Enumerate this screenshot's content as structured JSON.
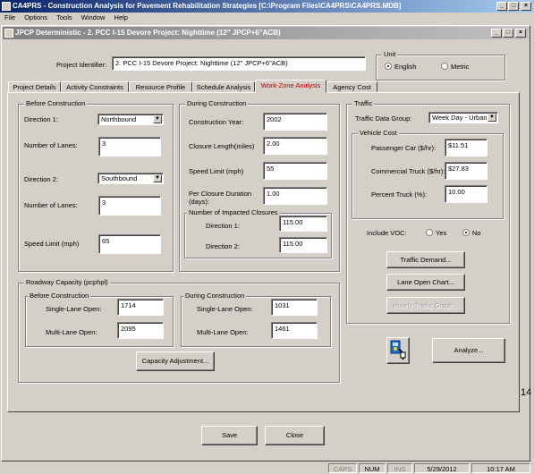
{
  "app": {
    "title": "CA4PRS - Construction Analysis for Pavement Rehabilitation Strategies [C:\\Program Files\\CA4PRS\\CA4PRS.MDB]",
    "menu": [
      "File",
      "Options",
      "Tools",
      "Window",
      "Help"
    ]
  },
  "child": {
    "title": "JPCP Deterministic - 2. PCC  I-15 Devore Project: Nighttime (12\" JPCP+6\"ACB)"
  },
  "project": {
    "label": "Project Identifier:",
    "value": "2. PCC  I-15 Devore Project: Nighttime (12\" JPCP+6\"ACB)"
  },
  "unit": {
    "legend": "Unit",
    "english": "English",
    "metric": "Metric",
    "selected": "English"
  },
  "tabs": [
    {
      "label": "Project Details",
      "active": false
    },
    {
      "label": "Activity Constraints",
      "active": false
    },
    {
      "label": "Resource Profile",
      "active": false
    },
    {
      "label": "Schedule Analysis",
      "active": false
    },
    {
      "label": "Work-Zone Analysis",
      "active": true
    },
    {
      "label": "Agency Cost",
      "active": false
    }
  ],
  "before": {
    "legend": "Before Construction",
    "dir1_label": "Direction 1:",
    "dir1_value": "Northbound",
    "lanes1_label": "Number of Lanes:",
    "lanes1_value": "3",
    "dir2_label": "Direction 2:",
    "dir2_value": "Southbound",
    "lanes2_label": "Number of Lanes:",
    "lanes2_value": "3",
    "speed_label": "Speed Limit (mph)",
    "speed_value": "65"
  },
  "during": {
    "legend": "During Construction",
    "year_label": "Construction Year:",
    "year_value": "2002",
    "length_label": "Closure Length(miles)",
    "length_value": "2.00",
    "speed_label": "Speed Limit (mph)",
    "speed_value": "55",
    "duration_label": "Per Closure Duration (days):",
    "duration_value": "1.00",
    "impacted_legend": "Number of Impacted Closures",
    "impacted_dir1_label": "Direction 1:",
    "impacted_dir1_value": "115.00",
    "impacted_dir2_label": "Direction 2:",
    "impacted_dir2_value": "115.00"
  },
  "traffic": {
    "legend": "Traffic",
    "group_label": "Traffic Data Group:",
    "group_value": "Week Day - Urban",
    "vehicle_legend": "Vehicle Cost",
    "car_label": "Passenger Car ($/hr):",
    "car_value": "$11.51",
    "truck_label": "Commercial Truck ($/hr):",
    "truck_value": "$27.83",
    "pct_label": "Percent Truck (%):",
    "pct_value": "10.00",
    "voc_label": "Include VOC:",
    "voc_yes": "Yes",
    "voc_no": "No",
    "voc_selected": "No",
    "btn_demand": "Traffic Demand...",
    "btn_lane_chart": "Lane Open Chart...",
    "btn_hourly": "Hourly Traffic Graph..."
  },
  "capacity": {
    "legend": "Roadway Capacity (pcphpl)",
    "before_legend": "Before Construction",
    "before_single_label": "Single-Lane Open:",
    "before_single_value": "1714",
    "before_multi_label": "Multi-Lane Open:",
    "before_multi_value": "2095",
    "during_legend": "During Construction",
    "during_single_label": "Single-Lane Open:",
    "during_single_value": "1031",
    "during_multi_label": "Multi-Lane Open:",
    "during_multi_value": "1461",
    "adjust_btn": "Capacity Adjustment..."
  },
  "analyze_btn": "Analyze...",
  "side_number": "14",
  "footer": {
    "save": "Save",
    "close": "Close"
  },
  "status": {
    "caps": "CAPS",
    "num": "NUM",
    "ins": "INS",
    "date": "5/29/2012",
    "time": "10:17 AM"
  }
}
